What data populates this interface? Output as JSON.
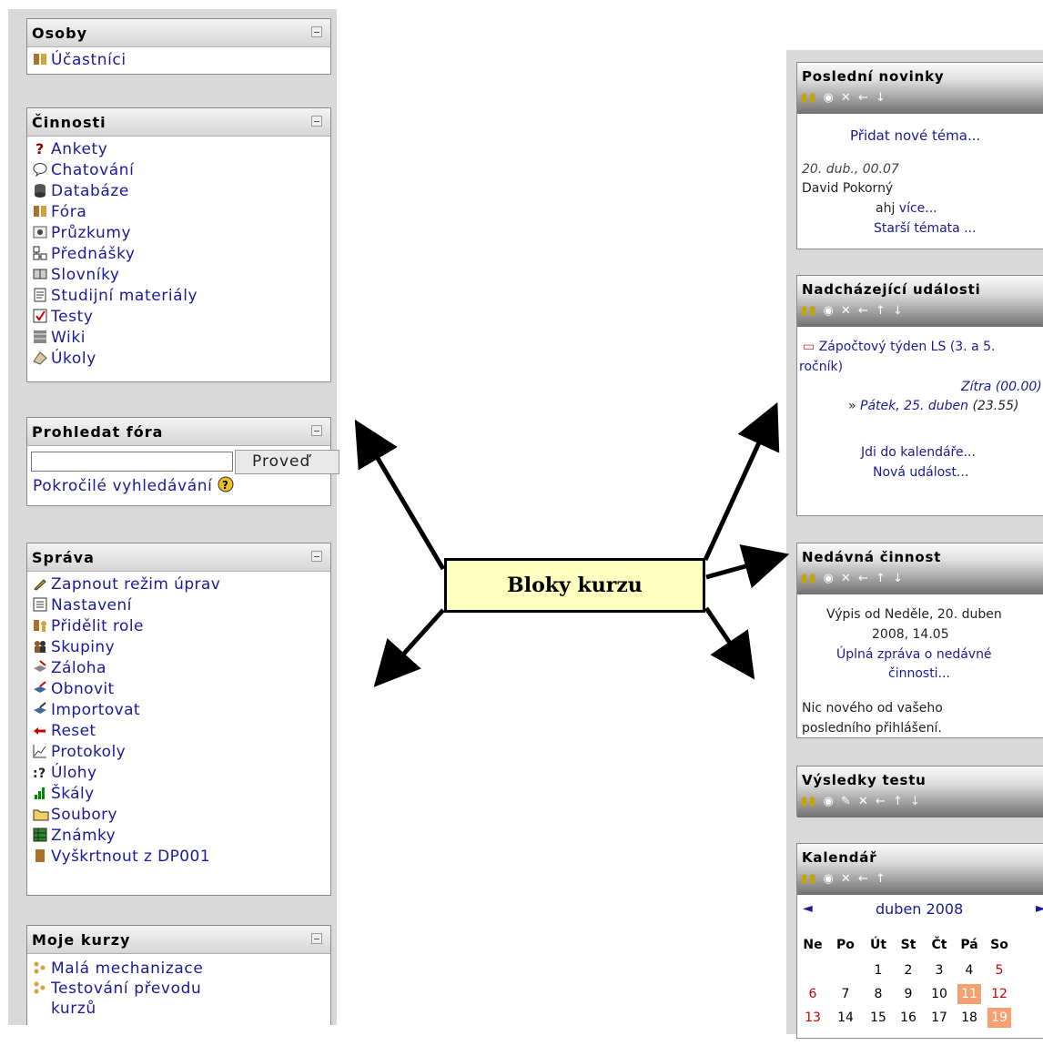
{
  "left_blocks": {
    "osoby": {
      "title": "Osoby",
      "items": [
        {
          "label": "Účastníci",
          "icon": "participants-icon"
        }
      ]
    },
    "cinnosti": {
      "title": "Činnosti",
      "items": [
        {
          "label": "Ankety",
          "icon": "question-icon"
        },
        {
          "label": "Chatování",
          "icon": "chat-icon"
        },
        {
          "label": "Databáze",
          "icon": "database-icon"
        },
        {
          "label": "Fóra",
          "icon": "forum-icon"
        },
        {
          "label": "Průzkumy",
          "icon": "survey-icon"
        },
        {
          "label": "Přednášky",
          "icon": "lesson-icon"
        },
        {
          "label": "Slovníky",
          "icon": "glossary-icon"
        },
        {
          "label": "Studijní materiály",
          "icon": "resource-icon"
        },
        {
          "label": "Testy",
          "icon": "quiz-icon"
        },
        {
          "label": "Wiki",
          "icon": "wiki-icon"
        },
        {
          "label": "Úkoly",
          "icon": "assignment-icon"
        }
      ]
    },
    "prohledat": {
      "title": "Prohledat fóra",
      "button": "Proveď",
      "advanced": "Pokročilé vyhledávání"
    },
    "sprava": {
      "title": "Správa",
      "items": [
        {
          "label": "Zapnout režim úprav",
          "icon": "edit-icon"
        },
        {
          "label": "Nastavení",
          "icon": "settings-icon"
        },
        {
          "label": "Přidělit role",
          "icon": "roles-icon"
        },
        {
          "label": "Skupiny",
          "icon": "groups-icon"
        },
        {
          "label": "Záloha",
          "icon": "backup-icon"
        },
        {
          "label": "Obnovit",
          "icon": "restore-icon"
        },
        {
          "label": "Importovat",
          "icon": "import-icon"
        },
        {
          "label": "Reset",
          "icon": "reset-icon"
        },
        {
          "label": "Protokoly",
          "icon": "logs-icon"
        },
        {
          "label": "Úlohy",
          "icon": "questions-icon"
        },
        {
          "label": "Škály",
          "icon": "scales-icon"
        },
        {
          "label": "Soubory",
          "icon": "folder-icon"
        },
        {
          "label": "Známky",
          "icon": "grades-icon"
        },
        {
          "label": "Vyškrtnout z DP001",
          "icon": "unenrol-icon"
        }
      ]
    },
    "moje_kurzy": {
      "title": "Moje kurzy",
      "items": [
        {
          "label": "Malá mechanizace",
          "icon": "course-icon"
        },
        {
          "label": "Testování převodu",
          "icon": "course-icon"
        },
        {
          "label": "kurzů",
          "icon": ""
        }
      ]
    }
  },
  "callout": "Bloky kurzu",
  "right_blocks": {
    "novinky": {
      "title": "Poslední novinky",
      "add": "Přidat nové téma...",
      "date": "20. dub., 00.07",
      "author": "David Pokorný",
      "excerpt": "ahj",
      "more": "více...",
      "older": "Starší témata ..."
    },
    "udalosti": {
      "title": "Nadcházející události",
      "event": "Zápočtový týden LS (3. a 5.",
      "event2": "ročník)",
      "when1": "Zítra (00.00)",
      "when2_prefix": "»",
      "when2": "Pátek, 25. duben",
      "when2_time": "(23.55)",
      "goto": "Jdi do kalendáře...",
      "new": "Nová událost..."
    },
    "cinnost": {
      "title": "Nedávná činnost",
      "line1": "Výpis od Neděle, 20. duben",
      "line2": "2008, 14.05",
      "report1": "Úplná zpráva o nedávné",
      "report2": "činnosti...",
      "nothing1": "Nic nového od vašeho",
      "nothing2": "posledního přihlášení."
    },
    "testy": {
      "title": "Výsledky testu"
    },
    "kalendar": {
      "title": "Kalendář",
      "month": "duben 2008",
      "days": [
        "Ne",
        "Po",
        "Út",
        "St",
        "Čt",
        "Pá",
        "So"
      ],
      "row1": [
        "",
        "",
        "1",
        "2",
        "3",
        "4",
        "5"
      ],
      "row2": [
        "6",
        "7",
        "8",
        "9",
        "10",
        "11",
        "12"
      ],
      "row3": [
        "13",
        "14",
        "15",
        "16",
        "17",
        "18",
        "19"
      ]
    }
  },
  "colors": {
    "link": "#1a1a9a",
    "weekend": "#cc0000",
    "highlight": "#f4a070",
    "callout_bg": "#ffffc0"
  }
}
